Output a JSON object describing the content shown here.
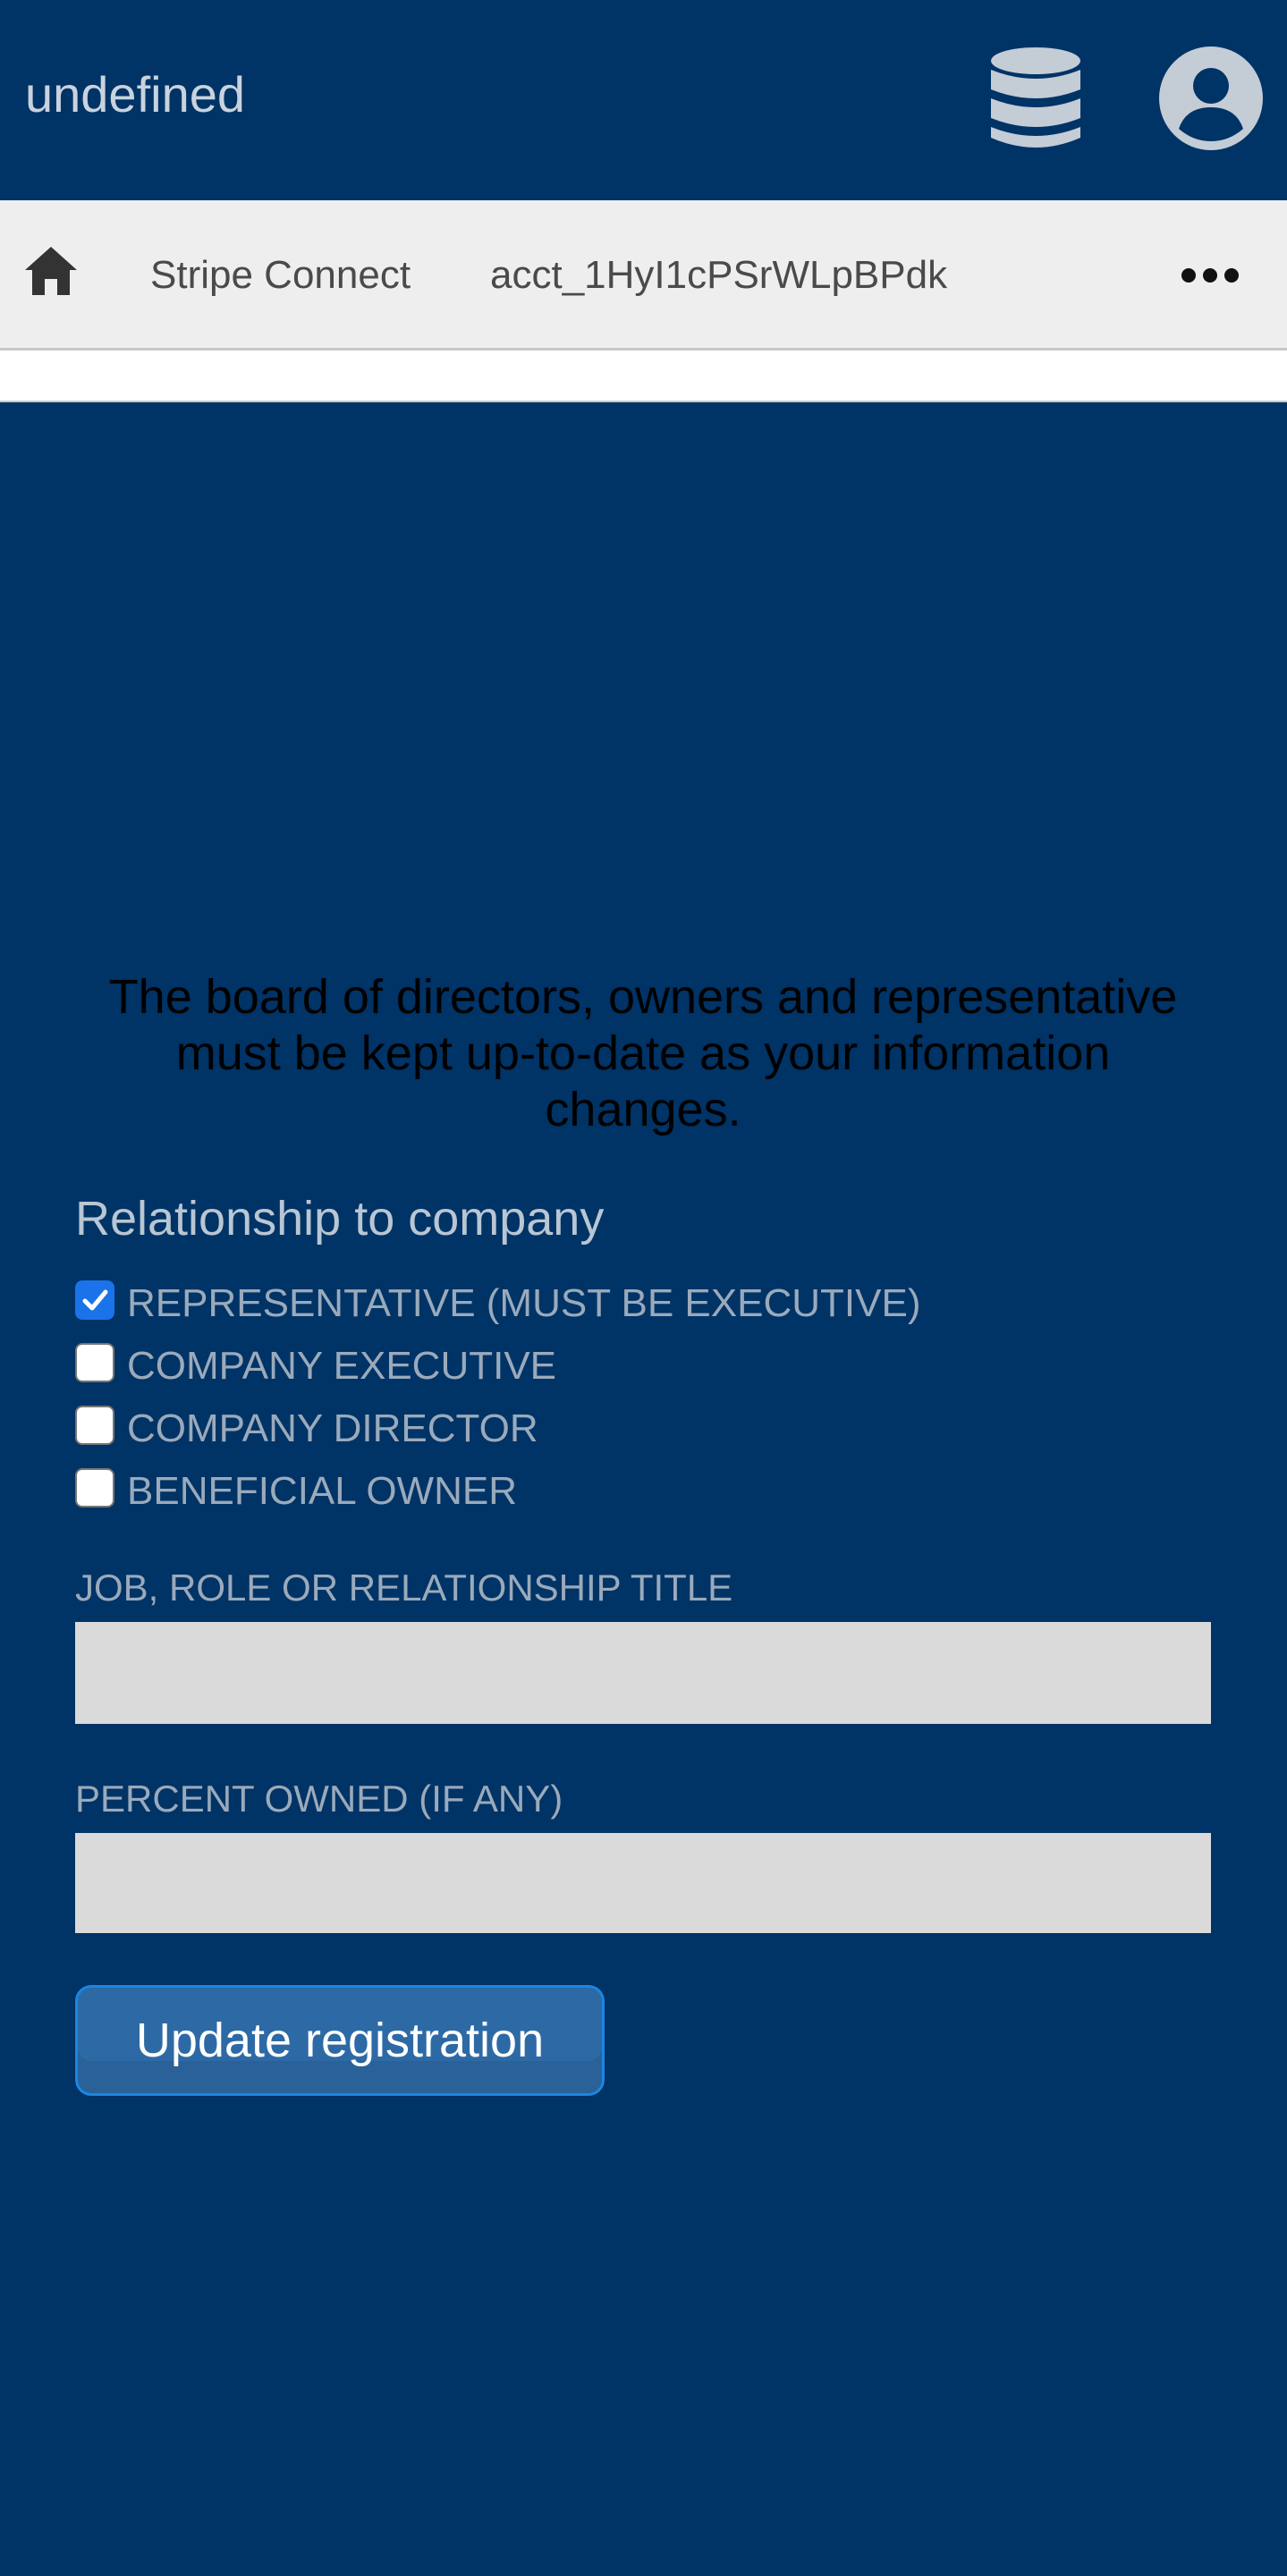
{
  "header": {
    "app_title": "undefined",
    "icons": [
      "database-icon",
      "user-icon"
    ]
  },
  "breadcrumb": {
    "items": [
      "Stripe Connect",
      "acct_1HyI1cPSrWLpBPdk"
    ],
    "icons": [
      "home-icon",
      "more-icon"
    ]
  },
  "notice": "The board of directors, owners and representative must be kept up-to-date as your information changes.",
  "relationship": {
    "title": "Relationship to company",
    "options": [
      {
        "label": "REPRESENTATIVE (MUST BE EXECUTIVE)",
        "checked": true
      },
      {
        "label": "COMPANY EXECUTIVE",
        "checked": false
      },
      {
        "label": "COMPANY DIRECTOR",
        "checked": false
      },
      {
        "label": "BENEFICIAL OWNER",
        "checked": false
      }
    ]
  },
  "fields": {
    "title_label": "JOB, ROLE OR RELATIONSHIP TITLE",
    "title_value": "",
    "percent_label": "PERCENT OWNED (IF ANY)",
    "percent_value": ""
  },
  "submit_label": "Update registration",
  "colors": {
    "background": "#003366",
    "breadcrumb_bg": "#eeeeee",
    "input_bg": "#dadada",
    "button_bg": "#2d6aa5",
    "checkbox_accent": "#1a73e8"
  }
}
